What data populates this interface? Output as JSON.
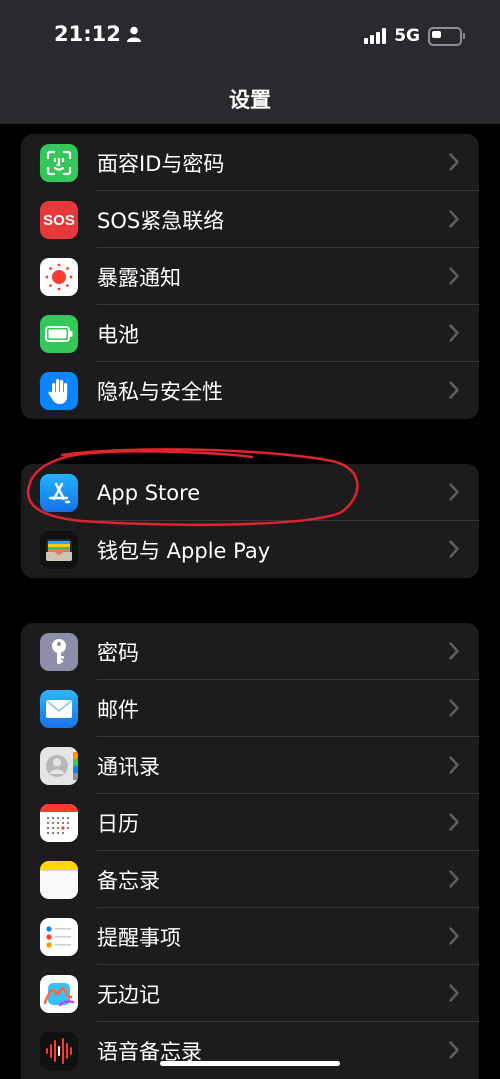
{
  "status": {
    "time": "21:12",
    "network": "5G"
  },
  "header": {
    "title": "设置"
  },
  "groups": [
    {
      "items": [
        {
          "label": "面容ID与密码",
          "icon": "face-id-icon",
          "color": "#34c759"
        },
        {
          "label": "SOS紧急联络",
          "icon": "sos-icon",
          "badge": "SOS",
          "color": "#e5393b"
        },
        {
          "label": "暴露通知",
          "icon": "exposure-icon",
          "color": "#ffffff"
        },
        {
          "label": "电池",
          "icon": "battery-icon",
          "color": "#34c759"
        },
        {
          "label": "隐私与安全性",
          "icon": "hand-icon",
          "color": "#0a84ff"
        }
      ]
    },
    {
      "items": [
        {
          "label": "App Store",
          "icon": "app-store-icon",
          "color": "#1a8cff"
        },
        {
          "label": "钱包与 Apple Pay",
          "icon": "wallet-icon",
          "color": "#1c1c1e"
        }
      ]
    },
    {
      "items": [
        {
          "label": "密码",
          "icon": "key-icon",
          "color": "#8e8ea8"
        },
        {
          "label": "邮件",
          "icon": "mail-icon",
          "color": "#1a8cff"
        },
        {
          "label": "通讯录",
          "icon": "contacts-icon",
          "color": "#d8d8d8"
        },
        {
          "label": "日历",
          "icon": "calendar-icon",
          "color": "#ffffff"
        },
        {
          "label": "备忘录",
          "icon": "notes-icon",
          "color": "#ffd60a"
        },
        {
          "label": "提醒事项",
          "icon": "reminders-icon",
          "color": "#ffffff"
        },
        {
          "label": "无边记",
          "icon": "freeform-icon",
          "color": "#ffffff"
        },
        {
          "label": "语音备忘录",
          "icon": "voice-memos-icon",
          "color": "#1c1c1e"
        }
      ]
    }
  ],
  "annotation": {
    "color": "#e0242b",
    "target": "App Store"
  }
}
